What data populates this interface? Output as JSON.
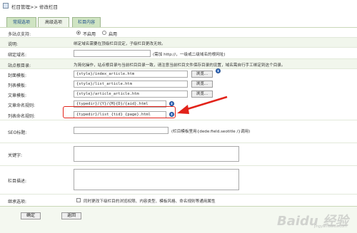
{
  "breadcrumb": "栏目管理>> 修改栏目",
  "tabs": [
    "常规选项",
    "高级选项",
    "栏目内容"
  ],
  "multisite": {
    "label": "多站点支持:",
    "opt_off": "不启用",
    "opt_on": "启用"
  },
  "desc": {
    "label": "说明:",
    "text": "绑定域名需要在顶级栏目设定，子级栏目更改无效。"
  },
  "domain": {
    "label": "绑定域名:",
    "value": "",
    "hint": "(需加 http://，一级或二级域名的根网址)"
  },
  "rules_hint": {
    "label": "站点根目录:",
    "text": "为简化操作，站点根目录与当前栏目目录一致，请注意当前栏目文件保存目录的设置，域名需自行手工绑定到这个目录。"
  },
  "cover_tpl": {
    "label": "封面模板:",
    "value": "{style}/index_article.htm",
    "button": "浏览..."
  },
  "list_tpl": {
    "label": "列表模板:",
    "value": "{style}/list_article.htm",
    "button": "浏览..."
  },
  "article_tpl": {
    "label": "文章模板:",
    "value": "{style}/article_article.htm",
    "button": "浏览..."
  },
  "article_rule": {
    "label": "文章命名规则:",
    "value": "{typedir}/{Y}/{M}{D}/{aid}.html"
  },
  "list_rule": {
    "label": "列表命名规则:",
    "value": "{typedir}/list_{tid}_{page}.html"
  },
  "seo": {
    "label": "SEO标题:",
    "value": "",
    "hint": "(栏目模板里用{dede:field.seotitle /}调用)"
  },
  "keywords": {
    "label": "关键字:"
  },
  "description": {
    "label": "栏目描述:"
  },
  "inherit": {
    "label": "继承选项:",
    "text": "同时更改下级栏目的浏览权限、内容类型、模板风格、命名规则等通用属性"
  },
  "footer": {
    "ok": "确定",
    "back": "返回"
  },
  "watermark": {
    "main": "Baidu 经验",
    "sub": "jingyan.baidu.com"
  },
  "colors": {
    "tab_bg": "#cfe4c2",
    "arrow": "#e2231a",
    "highlight_row": "#f1f6ec"
  }
}
